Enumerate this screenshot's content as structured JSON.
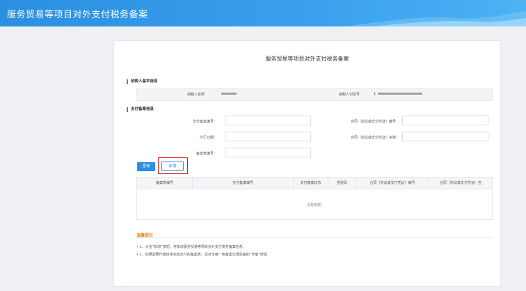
{
  "app": {
    "title": "服务贸易等项目对外支付税务备案"
  },
  "page": {
    "title": "服务贸易等项目对外支付税务备案"
  },
  "taxpayer": {
    "section_title": "纳税人基本信息",
    "name_label": "纳税人名称",
    "id_label": "纳税人识别号",
    "id_prefix": "1"
  },
  "payment": {
    "section_title": "支付备案信息",
    "fields": {
      "payment_no_label": "支付备案编号：",
      "contract_no_label": "合同（协议或支付凭证）编号：",
      "pay_date_label": "付汇日期：",
      "contract_name_label": "合同（协议或支付凭证）名称：",
      "filing_no_label": "备案表编号："
    },
    "inputs": {
      "payment_no": "",
      "contract_no": "",
      "pay_date": "",
      "contract_name": "",
      "filing_no": ""
    }
  },
  "buttons": {
    "query": "查询",
    "add": "新增"
  },
  "table": {
    "headers": [
      "备案表编号",
      "支付备案编号",
      "支付备案状态",
      "查验码",
      "合同（协议或支付凭证）编号",
      "合同（协议或支付凭证）名"
    ],
    "empty_text": "没有数据!"
  },
  "tips": {
    "title": "温馨提示",
    "items": [
      "• 1、点击“新增”按钮，可新增服务贸易等项目对外支付税务备案信息.",
      "• 2、如果需要作废尚未完成支付的备案表，请点击每一条备案记录后面的“作废”按钮."
    ]
  },
  "colors": {
    "accent": "#2a8fe0",
    "highlight": "#e02020",
    "tips": "#e28a1a"
  }
}
